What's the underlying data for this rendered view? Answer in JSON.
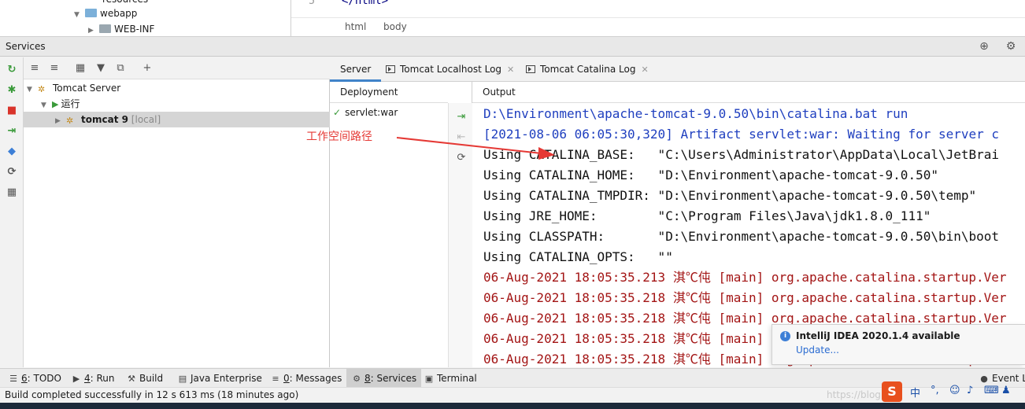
{
  "project_tree": {
    "items": [
      {
        "label": "resources"
      },
      {
        "label": "webapp"
      },
      {
        "label": "WEB-INF"
      }
    ]
  },
  "editor": {
    "line_number": "5",
    "code": "</html>",
    "breadcrumbs": [
      "html",
      "body"
    ]
  },
  "services": {
    "title": "Services",
    "tree": [
      {
        "label": "Tomcat Server"
      },
      {
        "label": "运行"
      },
      {
        "label": "tomcat 9",
        "suffix": "[local]"
      }
    ]
  },
  "tabs": [
    {
      "label": "Server"
    },
    {
      "label": "Tomcat Localhost Log"
    },
    {
      "label": "Tomcat Catalina Log"
    }
  ],
  "deployment": {
    "header": "Deployment",
    "items": [
      {
        "label": "servlet:war"
      }
    ]
  },
  "output": {
    "header": "Output",
    "lines": [
      {
        "text": "D:\\Environment\\apache-tomcat-9.0.50\\bin\\catalina.bat run",
        "color": "blue"
      },
      {
        "text": "[2021-08-06 06:05:30,320] Artifact servlet:war: Waiting for server c",
        "color": "blue"
      },
      {
        "text": "Using CATALINA_BASE:   \"C:\\Users\\Administrator\\AppData\\Local\\JetBrai",
        "color": "black"
      },
      {
        "text": "Using CATALINA_HOME:   \"D:\\Environment\\apache-tomcat-9.0.50\"",
        "color": "black"
      },
      {
        "text": "Using CATALINA_TMPDIR: \"D:\\Environment\\apache-tomcat-9.0.50\\temp\"",
        "color": "black"
      },
      {
        "text": "Using JRE_HOME:        \"C:\\Program Files\\Java\\jdk1.8.0_111\"",
        "color": "black"
      },
      {
        "text": "Using CLASSPATH:       \"D:\\Environment\\apache-tomcat-9.0.50\\bin\\boot",
        "color": "black"
      },
      {
        "text": "Using CATALINA_OPTS:   \"\"",
        "color": "black"
      },
      {
        "text": "06-Aug-2021 18:05:35.213 淇℃伅 [main] org.apache.catalina.startup.Ver",
        "color": "red"
      },
      {
        "text": "06-Aug-2021 18:05:35.218 淇℃伅 [main] org.apache.catalina.startup.Ver",
        "color": "red"
      },
      {
        "text": "06-Aug-2021 18:05:35.218 淇℃伅 [main] org.apache.catalina.startup.Ver",
        "color": "red"
      },
      {
        "text": "06-Aug-2021 18:05:35.218 淇℃伅 [main] org.apache.catalina.startup.Ve",
        "color": "red"
      },
      {
        "text": "06-Aug-2021 18:05:35.218 淇℃伅 [main] org.apache.catalina.startup.Ve",
        "color": "red"
      }
    ]
  },
  "annotation": {
    "text": "工作空间路径",
    "color": "#e53935"
  },
  "notification": {
    "title": "IntelliJ IDEA 2020.1.4 available",
    "link": "Update..."
  },
  "tool_windows": [
    {
      "key": "6",
      "label": ": TODO"
    },
    {
      "key": "4",
      "label": ": Run"
    },
    {
      "key": "",
      "label": "Build"
    },
    {
      "key": "",
      "label": "Java Enterprise"
    },
    {
      "key": "0",
      "label": ": Messages"
    },
    {
      "key": "8",
      "label": ": Services"
    },
    {
      "key": "",
      "label": "Terminal"
    },
    {
      "key": "",
      "label": "Event Lo"
    }
  ],
  "status": {
    "text": "Build completed successfully in 12 s 613 ms (18 minutes ago)",
    "watermark": "https://blog"
  },
  "ime": {
    "s": "S",
    "lang": "中"
  },
  "colors": {
    "accent": "#4083c9",
    "run_green": "#3a9a3a",
    "log_red": "#a31515",
    "log_blue": "#1f3fbf"
  }
}
